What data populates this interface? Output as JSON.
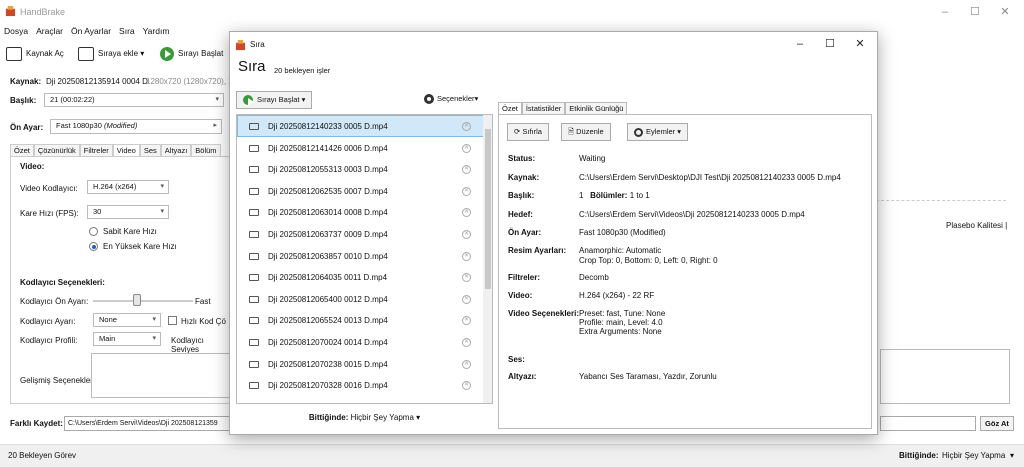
{
  "main": {
    "app_title": "HandBrake",
    "menu": [
      "Dosya",
      "Araçlar",
      "Ön Ayarlar",
      "Sıra",
      "Yardım"
    ],
    "toolbar": {
      "source_button": "Kaynak Aç",
      "add_queue_button": "Sıraya ekle",
      "start_queue_button": "Sırayı Başlat"
    },
    "source_label": "Kaynak:",
    "source_value": "Dji 20250812135914 0004 D",
    "source_info": "1280x720 (1280x720), 29",
    "title_label": "Başlık:",
    "title_value": "21 (00:02:22)",
    "preset_label": "Ön Ayar:",
    "preset_value": "Fast 1080p30",
    "preset_modified": "(Modified)",
    "tabs": [
      "Özet",
      "Çözünürlük",
      "Filtreler",
      "Video",
      "Ses",
      "Altyazı",
      "Bölüm"
    ],
    "active_tab": "Video",
    "video_heading": "Video:",
    "encoder_label": "Video Kodlayıcı:",
    "encoder_value": "H.264 (x264)",
    "framerate_label": "Kare Hızı (FPS):",
    "framerate_value": "30",
    "constant_fr": "Sabit Kare Hızı",
    "peak_fr": "En Yüksek Kare Hızı",
    "enc_options_heading": "Kodlayıcı Seçenekleri:",
    "enc_preset_label": "Kodlayıcı Ön Ayarı:",
    "enc_preset_value": "Fast",
    "tune_label": "Kodlayıcı Ayarı:",
    "tune_value": "None",
    "fast_decode_label": "Hızlı Kod Çö",
    "profile_label": "Kodlayıcı Profili:",
    "profile_value": "Main",
    "level_label": "Kodlayıcı Seviyes",
    "advanced_label": "Gelişmiş Seçenekler:",
    "quality_label": "Plasebo Kalitesi |",
    "save_as_label": "Farklı Kaydet:",
    "save_as_value": "C:\\Users\\Erdem Servi\\Videos\\Dji 202508121359",
    "browse_button": "Göz At",
    "status_left": "20 Bekleyen Görev",
    "when_done_label": "Bittiğinde:",
    "when_done_value": "Hiçbir Şey Yapma"
  },
  "queue": {
    "window_title": "Sıra",
    "heading": "Sıra",
    "subheading": "20 bekleyen işler",
    "start_button": "Sırayı Başlat",
    "options_button": "Seçenekler",
    "items": [
      "Dji 20250812140233 0005 D.mp4",
      "Dji 20250812141426 0006 D.mp4",
      "Dji 20250812055313 0003 D.mp4",
      "Dji 20250812062535 0007 D.mp4",
      "Dji 20250812063014 0008 D.mp4",
      "Dji 20250812063737 0009 D.mp4",
      "Dji 20250812063857 0010 D.mp4",
      "Dji 20250812064035 0011 D.mp4",
      "Dji 20250812065400 0012 D.mp4",
      "Dji 20250812065524 0013 D.mp4",
      "Dji 20250812070024 0014 D.mp4",
      "Dji 20250812070238 0015 D.mp4",
      "Dji 20250812070328 0016 D.mp4"
    ],
    "when_done_label": "Bittiğinde:",
    "when_done_value": "Hiçbir Şey Yapma",
    "detail_tabs": [
      "Özet",
      "İstatistikler",
      "Etkinlik Günlüğü"
    ],
    "reset_button": "Sıfırla",
    "edit_button": "Düzenle",
    "actions_button": "Eylemler",
    "details": {
      "status_label": "Status:",
      "status_value": "Waiting",
      "source_label": "Kaynak:",
      "source_value": "C:\\Users\\Erdem Servi\\Desktop\\DJI Test\\Dji 20250812140233 0005 D.mp4",
      "title_label": "Başlık:",
      "title_value_a": "1",
      "title_value_b": "Bölümler:",
      "title_value_c": "1 to 1",
      "dest_label": "Hedef:",
      "dest_value": "C:\\Users\\Erdem Servi\\Videos\\Dji 20250812140233 0005 D.mp4",
      "preset_label": "Ön Ayar:",
      "preset_value": "Fast 1080p30 (Modified)",
      "picture_label": "Resim Ayarları:",
      "picture_value_1": "Anamorphic: Automatic",
      "picture_value_2": "Crop Top: 0, Bottom: 0, Left: 0, Right: 0",
      "filters_label": "Filtreler:",
      "filters_value": "Decomb",
      "video_label": "Video:",
      "video_value": "H.264 (x264) - 22 RF",
      "video_opts_label": "Video Seçenekleri:",
      "video_opts_1": "Preset: fast, Tune: None",
      "video_opts_2": "Profile: main, Level: 4.0",
      "video_opts_3": "Extra Arguments: None",
      "audio_label": "Ses:",
      "subs_label": "Altyazı:",
      "subs_value": "Yabancı Ses Taraması, Yazdır, Zorunlu"
    }
  }
}
